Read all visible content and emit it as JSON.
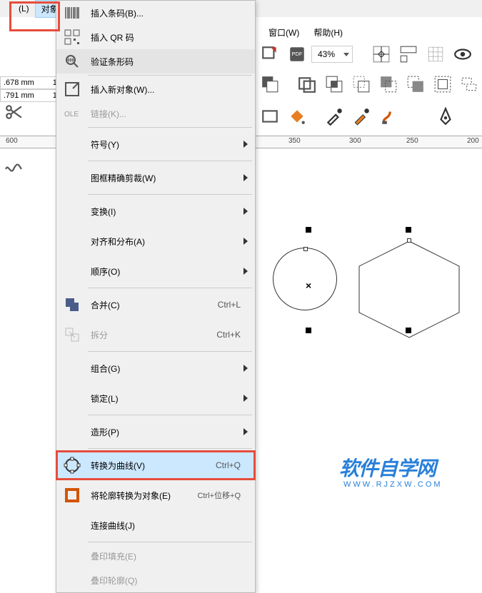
{
  "menubar": {
    "left_partial": "(L)",
    "object": "对象(C)",
    "window": "窗口(W)",
    "help": "帮助(H)"
  },
  "toolbar": {
    "zoom": "43%"
  },
  "dimensions": {
    "width": ".678 mm",
    "height": ".791 mm",
    "suffix": "1"
  },
  "ruler": {
    "ticks": [
      {
        "label": "600",
        "pos": 14
      },
      {
        "label": "350",
        "pos": 410
      },
      {
        "label": "300",
        "pos": 495
      },
      {
        "label": "250",
        "pos": 575
      },
      {
        "label": "200",
        "pos": 660
      }
    ]
  },
  "menu": {
    "items": [
      {
        "icon": "barcode-icon",
        "label": "插入条码(B)...",
        "sep": false
      },
      {
        "icon": "qr-icon",
        "label": "插入 QR 码",
        "sep": false
      },
      {
        "icon": "verify-barcode-icon",
        "label": "验证条形码",
        "sep": true,
        "highlighted": true
      },
      {
        "icon": "insert-object-icon",
        "label": "插入新对象(W)...",
        "sep": false
      },
      {
        "icon": "ole-link-icon",
        "label": "链接(K)...",
        "sep": true,
        "disabled": true
      },
      {
        "label": "符号(Y)",
        "arrow": true,
        "sep": true
      },
      {
        "label": "图框精确剪裁(W)",
        "arrow": true,
        "sep": true
      },
      {
        "label": "变换(I)",
        "arrow": true,
        "sep": false
      },
      {
        "label": "对齐和分布(A)",
        "arrow": true,
        "sep": false
      },
      {
        "label": "顺序(O)",
        "arrow": true,
        "sep": true
      },
      {
        "icon": "combine-icon",
        "label": "合并(C)",
        "shortcut": "Ctrl+L",
        "sep": false
      },
      {
        "icon": "break-icon",
        "label": "拆分",
        "shortcut": "Ctrl+K",
        "sep": true,
        "disabled": true
      },
      {
        "label": "组合(G)",
        "arrow": true,
        "sep": false
      },
      {
        "label": "锁定(L)",
        "arrow": true,
        "sep": true
      },
      {
        "label": "造形(P)",
        "arrow": true,
        "sep": true
      },
      {
        "icon": "convert-curve-icon",
        "label": "转换为曲线(V)",
        "shortcut": "Ctrl+Q",
        "hovered": true,
        "sep": false
      },
      {
        "icon": "outline-object-icon",
        "label": "将轮廓转换为对象(E)",
        "shortcut": "Ctrl+位移+Q",
        "sep": false
      },
      {
        "label": "连接曲线(J)",
        "sep": true
      },
      {
        "label": "叠印填充(E)",
        "disabled": true,
        "sep": false
      },
      {
        "label": "叠印轮廓(Q)",
        "disabled": true,
        "sep": false
      }
    ]
  },
  "watermark": {
    "main": "软件自学网",
    "sub": "WWW.RJZXW.COM"
  }
}
